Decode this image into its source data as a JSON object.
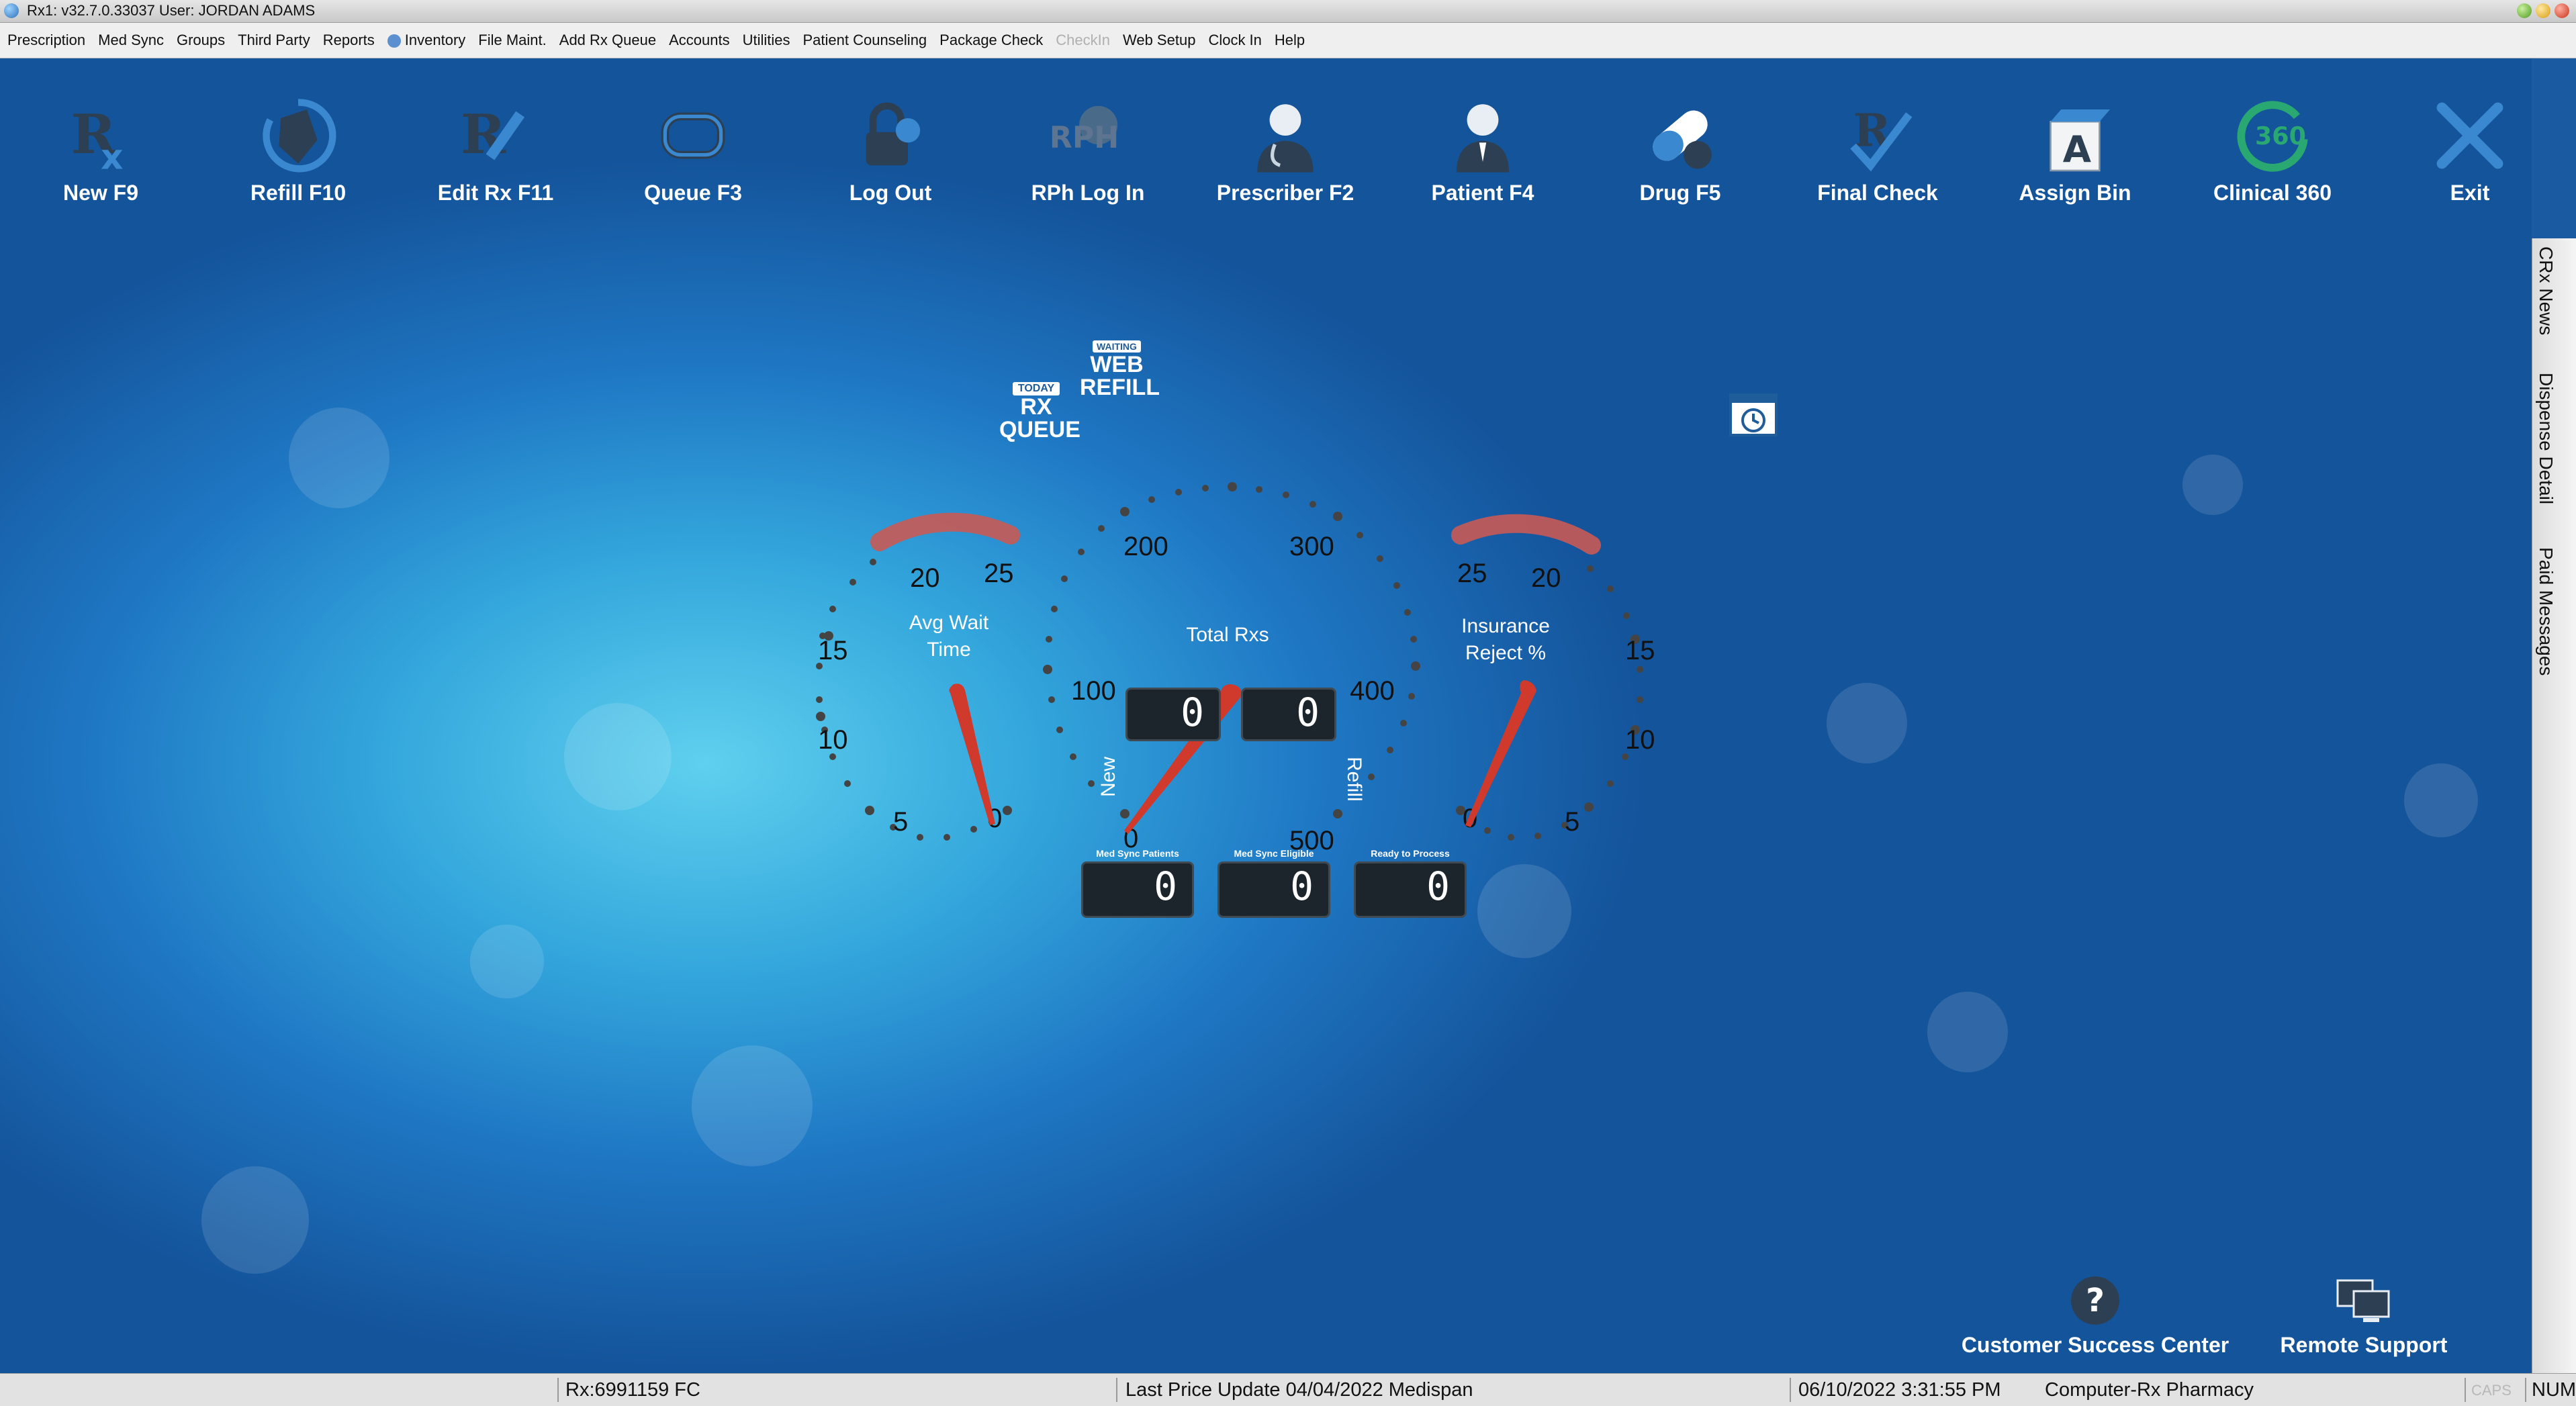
{
  "titlebar": {
    "title": "Rx1: v32.7.0.33037  User: JORDAN ADAMS"
  },
  "menu": [
    {
      "label": "Prescription"
    },
    {
      "label": "Med Sync"
    },
    {
      "label": "Groups"
    },
    {
      "label": "Third Party"
    },
    {
      "label": "Reports"
    },
    {
      "label": "Inventory"
    },
    {
      "label": "File Maint."
    },
    {
      "label": "Add Rx Queue"
    },
    {
      "label": "Accounts"
    },
    {
      "label": "Utilities"
    },
    {
      "label": "Patient Counseling"
    },
    {
      "label": "Package Check"
    },
    {
      "label": "CheckIn"
    },
    {
      "label": "Web Setup"
    },
    {
      "label": "Clock In"
    },
    {
      "label": "Help"
    }
  ],
  "toolbar": {
    "new": "New F9",
    "refill": "Refill F10",
    "edit": "Edit Rx F11",
    "queue": "Queue F3",
    "logout": "Log Out",
    "rph": "RPh Log In",
    "prescriber": "Prescriber F2",
    "patient": "Patient F4",
    "drug": "Drug F5",
    "finalcheck": "Final Check",
    "assignbin": "Assign Bin",
    "clinical": "Clinical 360",
    "exit": "Exit"
  },
  "dashboard": {
    "today_badge": "TODAY",
    "rx_queue_1": "RX",
    "rx_queue_2": "QUEUE",
    "web_badge": "WAITING",
    "web_refill_1": "WEB",
    "web_refill_2": "REFILL",
    "avg_wait": {
      "label_1": "Avg Wait",
      "label_2": "Time",
      "value": 0,
      "ticks": [
        "5",
        "10",
        "15",
        "20",
        "25"
      ]
    },
    "total_rxs": {
      "label": "Total Rxs",
      "value": 0,
      "ticks": [
        "0",
        "100",
        "200",
        "300",
        "400",
        "500"
      ],
      "new_label": "New",
      "new_value": "0",
      "refill_label": "Refill",
      "refill_value": "0"
    },
    "insurance": {
      "label_1": "Insurance",
      "label_2": "Reject %",
      "value": 0,
      "ticks": [
        "0",
        "5",
        "10",
        "15",
        "20",
        "25"
      ]
    },
    "avg_zero": "0",
    "counters": [
      {
        "label": "Med Sync Patients",
        "value": "0"
      },
      {
        "label": "Med Sync Eligible",
        "value": "0"
      },
      {
        "label": "Ready to Process",
        "value": "0"
      }
    ]
  },
  "side_tabs": [
    "CRx News",
    "Dispense Detail",
    "Paid Messages"
  ],
  "bottom": {
    "support_center": "Customer Success Center",
    "remote": "Remote Support"
  },
  "status": {
    "rx": "Rx:6991159 FC",
    "price_update": "Last Price Update 04/04/2022 Medispan",
    "datetime": "06/10/2022 3:31:55 PM",
    "pharmacy": "Computer-Rx Pharmacy",
    "caps": "CAPS",
    "num": "NUM"
  },
  "colors": {
    "needle": "#d03a2c",
    "arc": "#c85a55",
    "accent": "#1f78c4"
  }
}
